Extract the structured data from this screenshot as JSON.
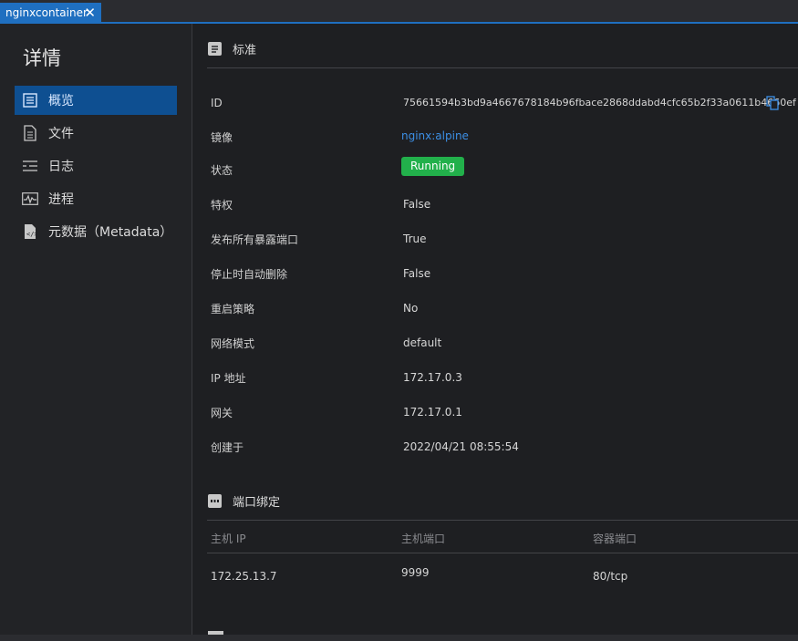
{
  "tab": {
    "title": "nginxcontainer"
  },
  "sidebar": {
    "title": "详情",
    "items": [
      {
        "label": "概览",
        "icon": "overview-icon"
      },
      {
        "label": "文件",
        "icon": "file-icon"
      },
      {
        "label": "日志",
        "icon": "log-icon"
      },
      {
        "label": "进程",
        "icon": "process-icon"
      },
      {
        "label": "元数据（Metadata）",
        "icon": "metadata-icon"
      }
    ]
  },
  "standard": {
    "title": "标准",
    "rows": [
      {
        "label": "ID",
        "value": "75661594b3bd9a4667678184b96fbace2868ddabd4cfc65b2f33a0611b4660ef"
      },
      {
        "label": "镜像",
        "value": "nginx:alpine"
      },
      {
        "label": "状态",
        "value": "Running"
      },
      {
        "label": "特权",
        "value": "False"
      },
      {
        "label": "发布所有暴露端口",
        "value": "True"
      },
      {
        "label": "停止时自动删除",
        "value": "False"
      },
      {
        "label": "重启策略",
        "value": "No"
      },
      {
        "label": "网络模式",
        "value": "default"
      },
      {
        "label": "IP 地址",
        "value": "172.17.0.3"
      },
      {
        "label": "网关",
        "value": "172.17.0.1"
      },
      {
        "label": "创建于",
        "value": "2022/04/21 08:55:54"
      }
    ]
  },
  "ports": {
    "title": "端口绑定",
    "headers": [
      "主机 IP",
      "主机端口",
      "容器端口"
    ],
    "rows": [
      {
        "host_ip": "172.25.13.7",
        "host_port": "9999",
        "container_port": "80/tcp"
      }
    ]
  },
  "colors": {
    "accent": "#1f6fc0",
    "running": "#22b04b",
    "link": "#3c8fe6",
    "active_nav": "#0e4f91"
  }
}
